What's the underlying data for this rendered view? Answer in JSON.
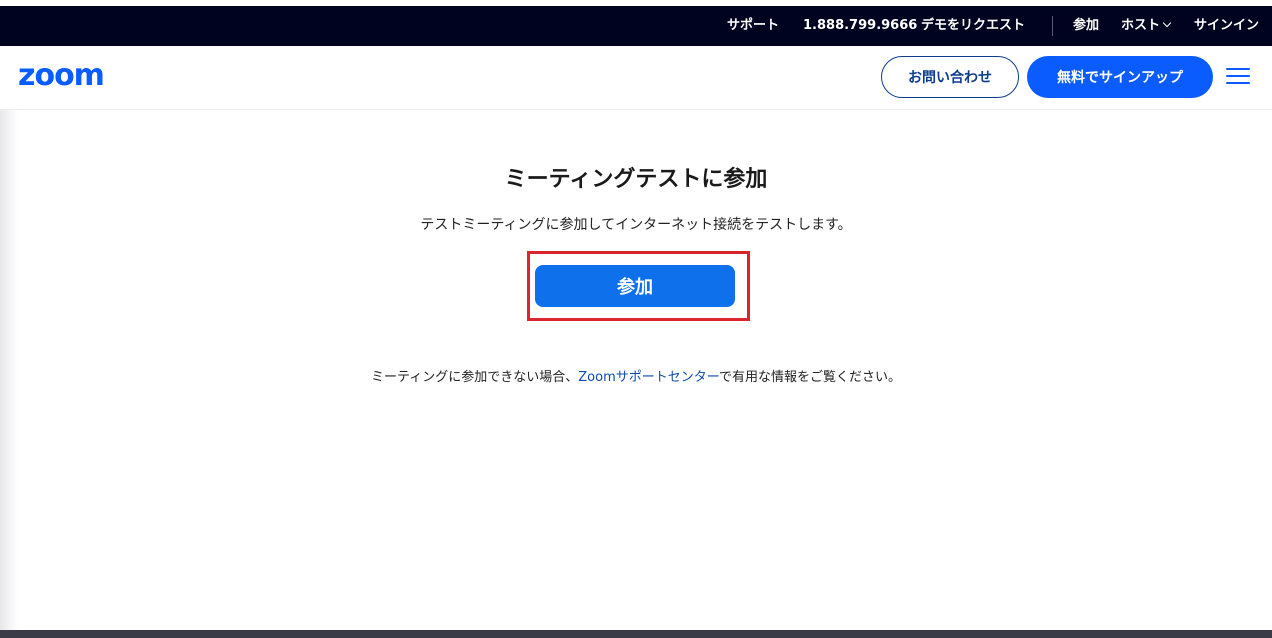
{
  "utility_bar": {
    "support": "サポート",
    "phone": "1.888.799.9666",
    "request_demo": "デモをリクエスト",
    "join": "参加",
    "host": "ホスト",
    "sign_in": "サインイン"
  },
  "header": {
    "logo_text": "zoom",
    "contact_button": "お問い合わせ",
    "signup_button": "無料でサインアップ",
    "menu_icon": "hamburger-menu-icon"
  },
  "main": {
    "title": "ミーティングテストに参加",
    "subtitle": "テストミーティングに参加してインターネット接続をテストします。",
    "join_button": "参加",
    "help_prefix": "ミーティングに参加できない場合、",
    "help_link": "Zoomサポートセンター",
    "help_suffix": "で有用な情報をご覧ください。"
  },
  "colors": {
    "brand_blue": "#0b5cff",
    "join_button": "#0e71eb",
    "utility_bg": "#00031f",
    "highlight_red": "#d9262c",
    "link_blue": "#0e4ba8"
  }
}
